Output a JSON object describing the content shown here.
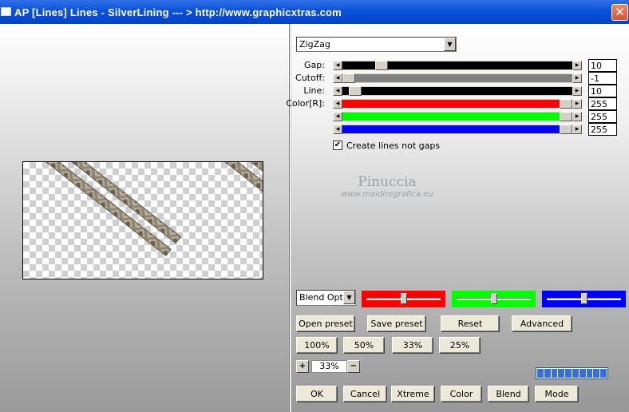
{
  "window": {
    "title": "AP [Lines]  Lines - SilverLining    --- > http://www.graphicxtras.com",
    "close_glyph": "✕"
  },
  "effect_select": {
    "value": "ZigZag"
  },
  "sliders": [
    {
      "label": "Gap:",
      "value": "10",
      "fill": 0.15,
      "track_color": "#000000"
    },
    {
      "label": "Cutoff:",
      "value": "-1",
      "fill": 0.0,
      "track_color": "#808080"
    },
    {
      "label": "Line:",
      "value": "10",
      "fill": 0.03,
      "track_color": "#000000"
    },
    {
      "label": "Color[R]:",
      "value": "255",
      "fill": 1.0,
      "track_color": "#ff0000"
    },
    {
      "label": "",
      "value": "255",
      "fill": 1.0,
      "track_color": "#00ff00"
    },
    {
      "label": "",
      "value": "255",
      "fill": 1.0,
      "track_color": "#0000ff"
    }
  ],
  "checkbox": {
    "label": "Create lines not gaps",
    "checked": true,
    "mark": "✔"
  },
  "watermark": {
    "name": "Pinuccia",
    "url": "www.maidiregrafica.eu"
  },
  "blend": {
    "select_value": "Blend Optio",
    "color_sliders": [
      {
        "color": "#ff0000",
        "level": 0.5
      },
      {
        "color": "#00ff00",
        "level": 0.5
      },
      {
        "color": "#0000ff",
        "level": 0.5
      }
    ]
  },
  "preset_buttons": [
    "Open preset",
    "Save preset",
    "Reset",
    "Advanced"
  ],
  "zoom_buttons": [
    "100%",
    "50%",
    "33%",
    "25%"
  ],
  "zoom": {
    "plus": "+",
    "value": "33%",
    "minus": "−"
  },
  "progress": {
    "cells": 10,
    "filled": 10
  },
  "bottom_buttons": [
    "OK",
    "Cancel",
    "Xtreme",
    "Color",
    "Blend",
    "Mode"
  ],
  "colors": {
    "titlebar": "#0a52d8",
    "preview_stroke": "#8a7f6c"
  }
}
